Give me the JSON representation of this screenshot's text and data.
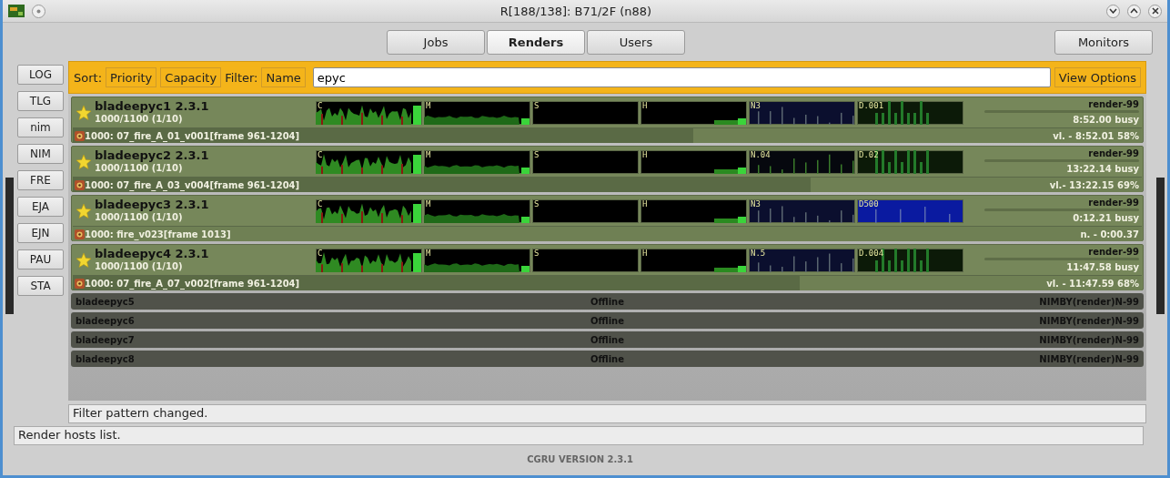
{
  "window": {
    "title": "R[188/138]: B71/2F (n88)"
  },
  "tabs": [
    {
      "label": "Jobs",
      "selected": false
    },
    {
      "label": "Renders",
      "selected": true
    },
    {
      "label": "Users",
      "selected": false
    }
  ],
  "monitors_button": "Monitors",
  "sidebar": {
    "buttons": [
      "LOG",
      "TLG",
      "nim",
      "NIM",
      "FRE",
      "EJA",
      "EJN",
      "PAU",
      "STA"
    ]
  },
  "filter_bar": {
    "sort_label": "Sort:",
    "sort_buttons": [
      "Priority",
      "Capacity"
    ],
    "filter_label": "Filter:",
    "filter_button": "Name",
    "filter_value": "epyc",
    "view_options": "View Options"
  },
  "hosts": [
    {
      "kind": "online",
      "name": "bladeepyc1 2.3.1",
      "capacity": "1000/1100 (1/10)",
      "graphs": [
        {
          "label": "C",
          "color": "#000000"
        },
        {
          "label": "M",
          "color": "#000000"
        },
        {
          "label": "S",
          "color": "#000000"
        },
        {
          "label": "H",
          "color": "#000000"
        },
        {
          "label": "N3",
          "color": "#0b0f2e"
        },
        {
          "label": "D.001",
          "color": "#0c1a08"
        }
      ],
      "pool": "render-99",
      "busy": "8:52.00 busy",
      "task": "1000: 07_fire_A_01_v001[frame 961-1204]",
      "task_status": "vl. - 8:52.01 58%",
      "level": 0.58
    },
    {
      "kind": "online",
      "name": "bladeepyc2 2.3.1",
      "capacity": "1000/1100 (1/10)",
      "graphs": [
        {
          "label": "C",
          "color": "#000000"
        },
        {
          "label": "M",
          "color": "#000000"
        },
        {
          "label": "S",
          "color": "#000000"
        },
        {
          "label": "H",
          "color": "#000000"
        },
        {
          "label": "N.04",
          "color": "#06080e"
        },
        {
          "label": "D.02",
          "color": "#0c1a08"
        }
      ],
      "pool": "render-99",
      "busy": "13:22.14 busy",
      "task": "1000: 07_fire_A_03_v004[frame 961-1204]",
      "task_status": "vl.- 13:22.15 69%",
      "level": 0.69
    },
    {
      "kind": "online",
      "name": "bladeepyc3 2.3.1",
      "capacity": "1000/1100 (1/10)",
      "graphs": [
        {
          "label": "C",
          "color": "#000000"
        },
        {
          "label": "M",
          "color": "#000000"
        },
        {
          "label": "S",
          "color": "#000000"
        },
        {
          "label": "H",
          "color": "#000000"
        },
        {
          "label": "N3",
          "color": "#0b0f2e"
        },
        {
          "label": "D500",
          "color": "#0a1aa0"
        }
      ],
      "pool": "render-99",
      "busy": "0:12.21 busy",
      "task": "1000: fire_v023[frame 1013]",
      "task_status": "n. - 0:00.37",
      "level": 0
    },
    {
      "kind": "online",
      "name": "bladeepyc4 2.3.1",
      "capacity": "1000/1100 (1/10)",
      "graphs": [
        {
          "label": "C",
          "color": "#000000"
        },
        {
          "label": "M",
          "color": "#000000"
        },
        {
          "label": "S",
          "color": "#000000"
        },
        {
          "label": "H",
          "color": "#000000"
        },
        {
          "label": "N.5",
          "color": "#0b0f2e"
        },
        {
          "label": "D.004",
          "color": "#0c1a08"
        }
      ],
      "pool": "render-99",
      "busy": "11:47.58 busy",
      "task": "1000: 07_fire_A_07_v002[frame 961-1204]",
      "task_status": "vl. - 11:47.59 68%",
      "level": 0.68
    },
    {
      "kind": "offline",
      "name": "bladeepyc5",
      "state": "Offline",
      "status": "NIMBY(render)N-99"
    },
    {
      "kind": "offline",
      "name": "bladeepyc6",
      "state": "Offline",
      "status": "NIMBY(render)N-99"
    },
    {
      "kind": "offline",
      "name": "bladeepyc7",
      "state": "Offline",
      "status": "NIMBY(render)N-99"
    },
    {
      "kind": "offline",
      "name": "bladeepyc8",
      "state": "Offline",
      "status": "NIMBY(render)N-99"
    }
  ],
  "task_message": "Filter pattern changed.",
  "status_bar": "Render hosts list.",
  "version": "CGRU VERSION 2.3.1"
}
